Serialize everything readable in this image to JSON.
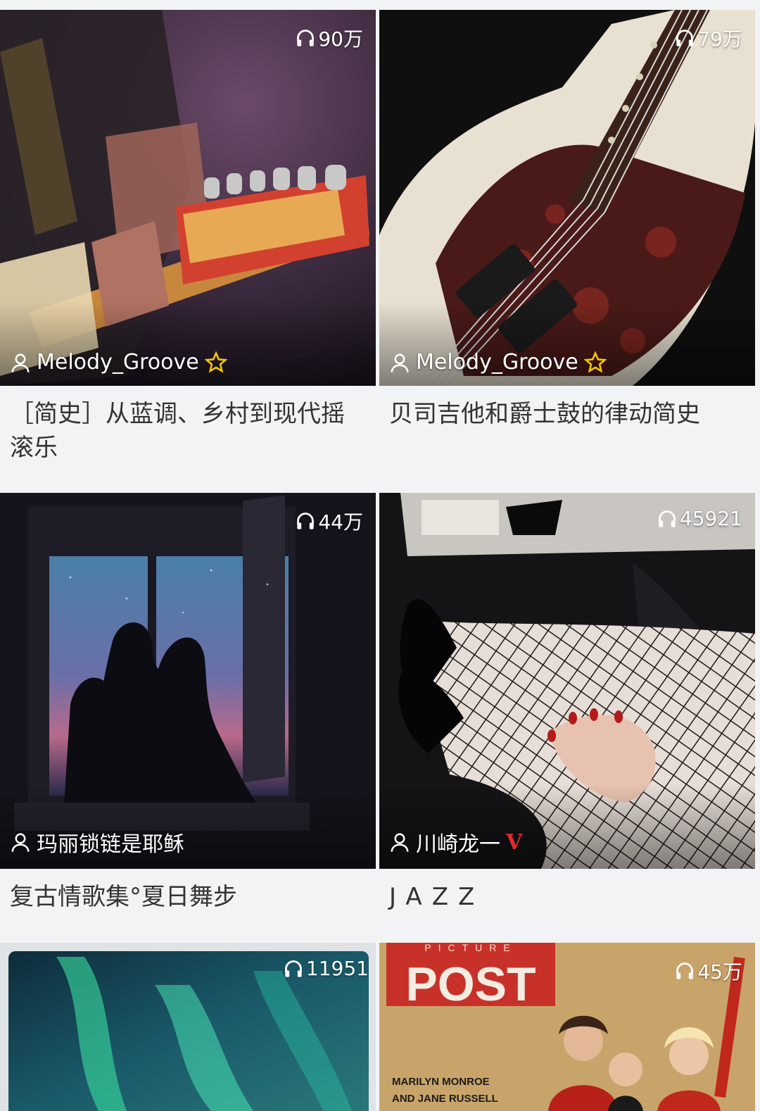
{
  "cards": [
    {
      "plays": "90万",
      "author": "Melody_Groove",
      "author_badge": "star",
      "title": "［简史］从蓝调、乡村到现代摇滚乐"
    },
    {
      "plays": "79万",
      "author": "Melody_Groove",
      "author_badge": "star",
      "title": "贝司吉他和爵士鼓的律动简史"
    },
    {
      "plays": "44万",
      "author": "玛丽锁链是耶稣",
      "author_badge": "",
      "title": "复古情歌集°夏日舞步"
    },
    {
      "plays": "45921",
      "author": "川崎龙一",
      "author_badge": "V",
      "title": "JAZZ"
    },
    {
      "plays": "11951",
      "author": "",
      "author_badge": "",
      "title": ""
    },
    {
      "plays": "45万",
      "author": "",
      "author_badge": "",
      "title": ""
    }
  ],
  "covers": {
    "post_header": "PICTURE",
    "post_title": "POST",
    "post_caption_1": "MARILYN MONROE",
    "post_caption_2": "AND JANE RUSSELL"
  },
  "colors": {
    "star": "#f2c200",
    "vip": "#e02b2b",
    "background": "#f2f3f5",
    "title_text": "#333333"
  }
}
